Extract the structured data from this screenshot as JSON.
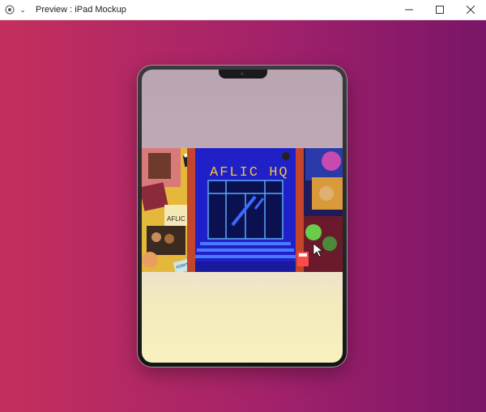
{
  "window": {
    "title": "Preview : iPad Mockup",
    "controls": [
      "minimize",
      "maximize",
      "close"
    ]
  },
  "banner": {
    "sign_text": "AFLIC HQ",
    "ticket_text": "ADMIT ONE",
    "sticker_text": "AFLIC HQ"
  },
  "colors": {
    "bg_left": "#c42f5d",
    "bg_right": "#7a1568",
    "building_blue": "#2020c8",
    "sign_yellow": "#f2c23a"
  }
}
